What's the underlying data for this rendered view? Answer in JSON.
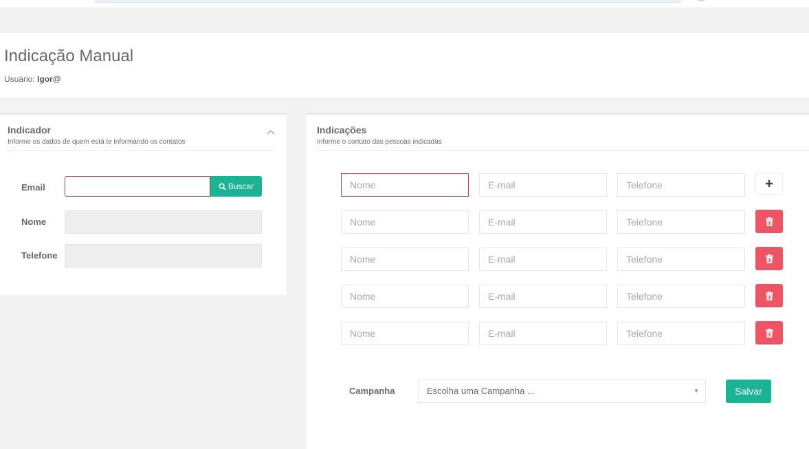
{
  "page": {
    "title": "Indicação Manual",
    "user_label": "Usuário:",
    "user_name": "Igor@"
  },
  "indicador": {
    "title": "Indicador",
    "subtitle": "Informe os dados de quem está te informando os contatos",
    "email_label": "Email",
    "email_value": "",
    "buscar_label": "Buscar",
    "nome_label": "Nome",
    "nome_value": "",
    "telefone_label": "Telefone",
    "telefone_value": ""
  },
  "indicacoes": {
    "title": "Indicações",
    "subtitle": "Informe o contato das pessoas indicadas",
    "placeholders": {
      "nome": "Nome",
      "email": "E-mail",
      "telefone": "Telefone"
    },
    "rows": [
      {
        "nome": "",
        "email": "",
        "telefone": "",
        "action": "add"
      },
      {
        "nome": "",
        "email": "",
        "telefone": "",
        "action": "delete"
      },
      {
        "nome": "",
        "email": "",
        "telefone": "",
        "action": "delete"
      },
      {
        "nome": "",
        "email": "",
        "telefone": "",
        "action": "delete"
      },
      {
        "nome": "",
        "email": "",
        "telefone": "",
        "action": "delete"
      }
    ],
    "campanha_label": "Campanha",
    "campanha_placeholder": "Escolha uma Campanha ...",
    "salvar_label": "Salvar"
  },
  "colors": {
    "primary": "#1ab394",
    "danger": "#ed5565",
    "error_border": "#a94442"
  },
  "icons": {
    "collapse": "chevron-up-icon",
    "buscar": "search-icon",
    "add": "plus-icon",
    "delete": "trash-icon"
  }
}
